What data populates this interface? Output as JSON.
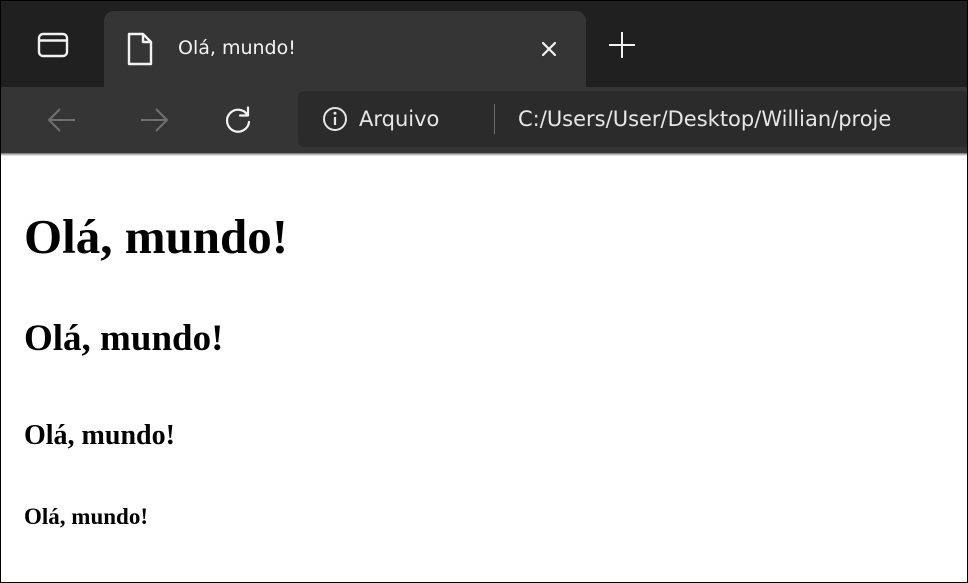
{
  "tab": {
    "title": "Olá, mundo!"
  },
  "toolbar": {
    "site_info_label": "Arquivo",
    "url": "C:/Users/User/Desktop/Willian/proje"
  },
  "page": {
    "heading1": "Olá, mundo!",
    "heading2": "Olá, mundo!",
    "heading3": "Olá, mundo!",
    "heading4": "Olá, mundo!"
  },
  "icons": {
    "tab_actions": "tab-actions-icon",
    "tab_page": "page-icon",
    "tab_close": "close-icon",
    "new_tab": "plus-icon",
    "back": "arrow-left-icon",
    "forward": "arrow-right-icon",
    "refresh": "refresh-icon",
    "site_info": "info-icon"
  },
  "colors": {
    "tabstrip_bg": "#202020",
    "active_tab_bg": "#353535",
    "toolbar_bg": "#353535",
    "address_bar_bg": "#2b2b2b",
    "tab_text": "#f3f3f3",
    "disabled_icon": "#707070",
    "page_bg": "#ffffff",
    "page_text": "#000000"
  }
}
